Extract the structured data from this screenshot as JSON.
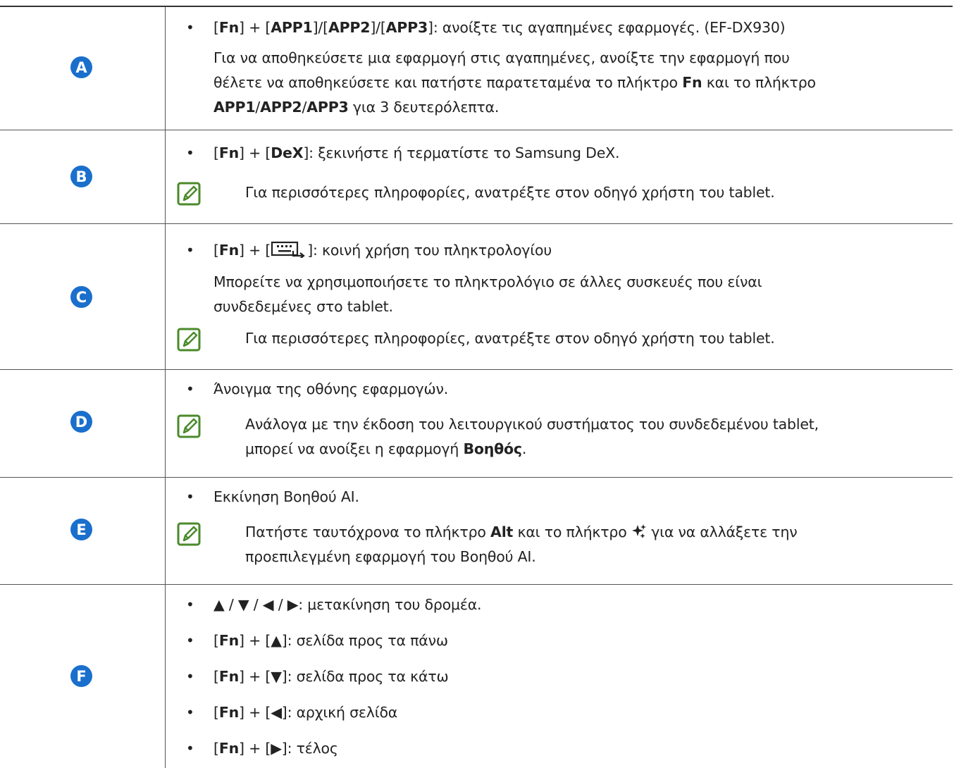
{
  "rows": [
    {
      "badge": "A",
      "line1": {
        "p1": "[",
        "fn": "Fn",
        "p2": "] + [",
        "a1": "APP1",
        "p3": "]/[",
        "a2": "APP2",
        "p4": "]/[",
        "a3": "APP3",
        "p5": "]: ανοίξτε τις αγαπημένες εφαρμογές. (EF-DX930)"
      },
      "line2": "Για να αποθηκεύσετε μια εφαρμογή στις αγαπημένες, ανοίξτε την εφαρμογή που",
      "line3": {
        "t1": "θέλετε να αποθηκεύσετε και πατήστε παρατεταμένα το πλήκτρο ",
        "fn": "Fn",
        "t2": " και το πλήκτρο"
      },
      "line4": {
        "a1": "APP1",
        "s1": "/",
        "a2": "APP2",
        "s2": "/",
        "a3": "APP3",
        "t": " για 3 δευτερόλεπτα."
      }
    },
    {
      "badge": "B",
      "line1": {
        "p1": "[",
        "fn": "Fn",
        "p2": "] + [",
        "dex": "DeX",
        "p3": "]: ξεκινήστε ή τερματίστε το Samsung DeX."
      },
      "note": "Για περισσότερες πληροφορίες, ανατρέξτε στον οδηγό χρήστη του tablet."
    },
    {
      "badge": "C",
      "line1": {
        "p1": "[",
        "fn": "Fn",
        "p2": "] + [",
        "p3": "]: κοινή χρήση του πληκτρολογίου"
      },
      "line2": "Μπορείτε να χρησιμοποιήσετε το πληκτρολόγιο σε άλλες συσκευές που είναι",
      "line3": "συνδεδεμένες στο tablet.",
      "note": "Για περισσότερες πληροφορίες, ανατρέξτε στον οδηγό χρήστη του tablet."
    },
    {
      "badge": "D",
      "line1": "Άνοιγμα της οθόνης εφαρμογών.",
      "note1": "Ανάλογα με την έκδοση του λειτουργικού συστήματος του συνδεδεμένου tablet,",
      "note2": {
        "t": "μπορεί να ανοίξει η εφαρμογή ",
        "b": "Βοηθός",
        "end": "."
      }
    },
    {
      "badge": "E",
      "line1": "Εκκίνηση Βοηθού AI.",
      "note1": {
        "t1": "Πατήστε ταυτόχρονα το πλήκτρο ",
        "alt": "Alt",
        "t2": " και το πλήκτρο ",
        "t3": " για να αλλάξετε την"
      },
      "note2": "προεπιλεγμένη εφαρμογή του Βοηθού AI."
    },
    {
      "badge": "F",
      "items": [
        {
          "pre": "",
          "fn": "",
          "text": "▲ / ▼ / ◀ / ▶: μετακίνηση του δρομέα."
        },
        {
          "pre": "[",
          "fn": "Fn",
          "text": "] + [▲]: σελίδα προς τα πάνω"
        },
        {
          "pre": "[",
          "fn": "Fn",
          "text": "] + [▼]: σελίδα προς τα κάτω"
        },
        {
          "pre": "[",
          "fn": "Fn",
          "text": "] + [◀]: αρχική σελίδα"
        },
        {
          "pre": "[",
          "fn": "Fn",
          "text": "] + [▶]: τέλος"
        }
      ]
    }
  ],
  "bullet": "•",
  "colors": {
    "badge": "#1a6fcc",
    "note_icon": "#4a8a2a"
  }
}
